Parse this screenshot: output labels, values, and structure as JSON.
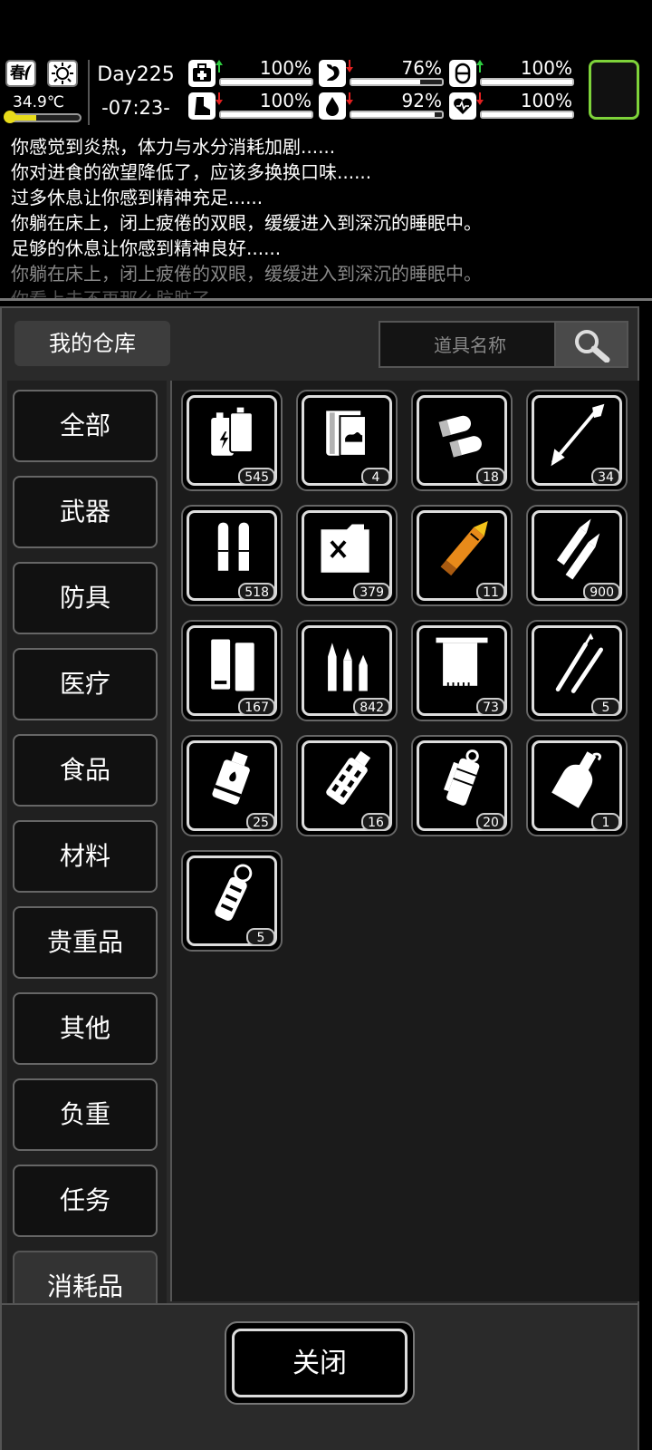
{
  "status": {
    "season": "春",
    "temperature": "34.9℃",
    "temperature_level": 0.4,
    "day": "Day225",
    "clock": "-07:23-",
    "stats": [
      {
        "icon": "medkit-icon",
        "trend": "up",
        "value": "100%",
        "level": 1.0
      },
      {
        "icon": "stomach-icon",
        "trend": "down",
        "value": "76%",
        "level": 0.76
      },
      {
        "icon": "pill-icon",
        "trend": "up",
        "value": "100%",
        "level": 1.0
      },
      {
        "icon": "boot-icon",
        "trend": "down",
        "value": "100%",
        "level": 1.0
      },
      {
        "icon": "water-drop-icon",
        "trend": "down",
        "value": "92%",
        "level": 0.92
      },
      {
        "icon": "heart-icon",
        "trend": "down",
        "value": "100%",
        "level": 1.0
      }
    ],
    "colors": {
      "up": "#2ecc40",
      "down": "#e02020",
      "accent": "#7ed33a"
    }
  },
  "log": [
    "你感觉到炎热，体力与水分消耗加剧......",
    "你对进食的欲望降低了，应该多换换口味......",
    "过多休息让你感到精神充足......",
    "你躺在床上，闭上疲倦的双眼，缓缓进入到深沉的睡眠中。",
    "足够的休息让你感到精神良好......",
    "你躺在床上，闭上疲倦的双眼，缓缓进入到深沉的睡眠中。",
    "你看上去不再那么肮脏了......"
  ],
  "panel": {
    "title": "我的仓库",
    "search_placeholder": "道具名称",
    "categories": [
      "全部",
      "武器",
      "防具",
      "医疗",
      "食品",
      "材料",
      "贵重品",
      "其他",
      "负重",
      "任务",
      "消耗品"
    ],
    "items": [
      {
        "icon": "battery-icon",
        "count": "545"
      },
      {
        "icon": "book-icon",
        "count": "4"
      },
      {
        "icon": "shotgun-shell-icon",
        "count": "18"
      },
      {
        "icon": "arrow-icon",
        "count": "34"
      },
      {
        "icon": "pistol-ammo-icon",
        "count": "518"
      },
      {
        "icon": "fuel-can-icon",
        "count": "379"
      },
      {
        "icon": "rocket-icon",
        "count": "11"
      },
      {
        "icon": "rifle-rounds-icon",
        "count": "900"
      },
      {
        "icon": "magazine-icon",
        "count": "167"
      },
      {
        "icon": "bullets-icon",
        "count": "842"
      },
      {
        "icon": "towel-icon",
        "count": "73"
      },
      {
        "icon": "lockpick-icon",
        "count": "5"
      },
      {
        "icon": "incendiary-grenade-icon",
        "count": "25"
      },
      {
        "icon": "stun-grenade-icon",
        "count": "16"
      },
      {
        "icon": "smoke-grenade-icon",
        "count": "20"
      },
      {
        "icon": "molotov-icon",
        "count": "1"
      },
      {
        "icon": "flashbang-icon",
        "count": "5"
      }
    ],
    "close_label": "关闭"
  }
}
